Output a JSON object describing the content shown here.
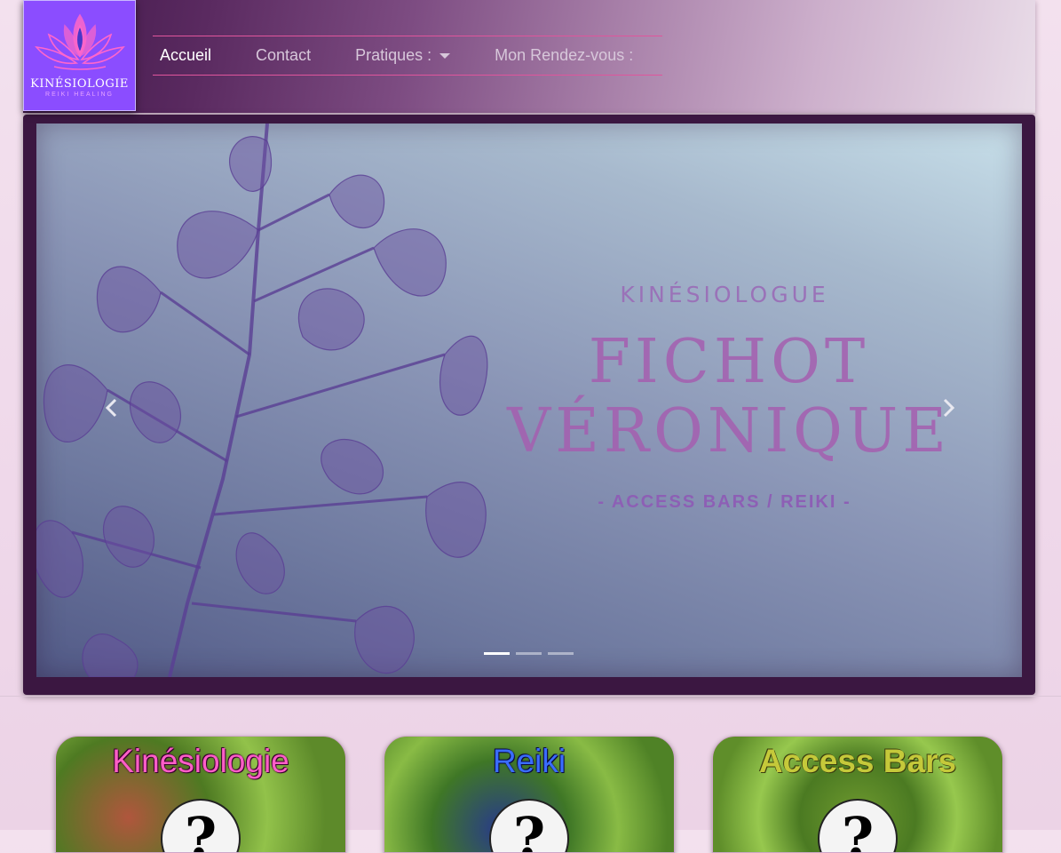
{
  "logo": {
    "title": "KINÉSIOLOGIE",
    "subtitle": "REIKI HEALING"
  },
  "nav": {
    "items": [
      {
        "label": "Accueil",
        "active": true
      },
      {
        "label": "Contact",
        "active": false
      },
      {
        "label": "Pratiques :",
        "active": false,
        "dropdown": true
      },
      {
        "label": "Mon Rendez-vous :",
        "active": false
      }
    ]
  },
  "carousel": {
    "subtitle": "KINÉSIOLOGUE",
    "title_line1": "FICHOT",
    "title_line2": "VÉRONIQUE",
    "tagline": "- ACCESS BARS / REIKI -",
    "slide_count": 3,
    "active_slide": 1
  },
  "cards": [
    {
      "title": "Kinésiologie",
      "icon": "question-mark",
      "color": "#ff5ec7"
    },
    {
      "title": "Reiki",
      "icon": "question-mark",
      "color": "#3a6dff"
    },
    {
      "title": "Access Bars",
      "icon": "question-mark",
      "color": "#c5c93a"
    }
  ]
}
